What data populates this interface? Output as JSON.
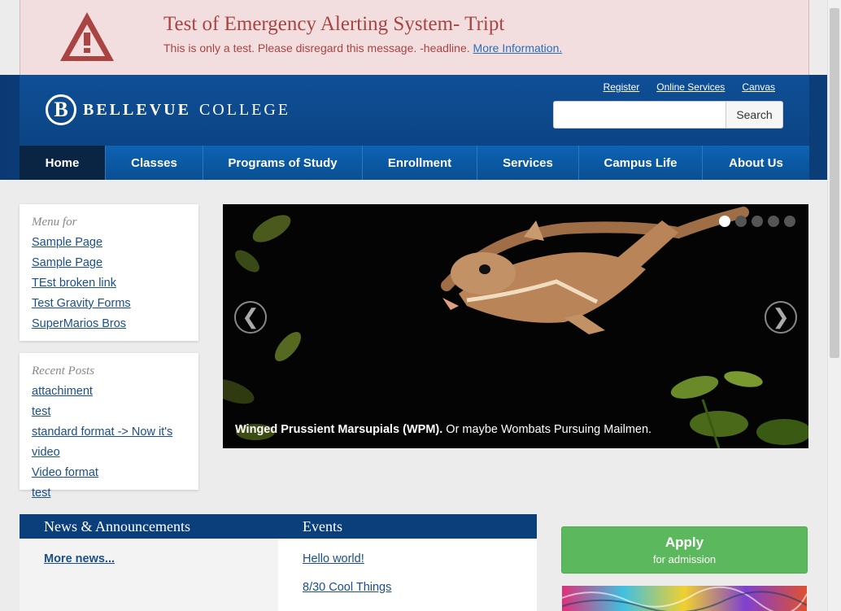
{
  "alert": {
    "title": "Test of Emergency Alerting System- Tript",
    "message": "This is only a test. Please disregard this message. -headline.",
    "link": "More Information.",
    "color": "#a94442"
  },
  "header": {
    "logo_mark": "B",
    "logo_bold": "BELLEVUE",
    "logo_rest": "COLLEGE",
    "toplinks": [
      "Register",
      "Online Services",
      "Canvas"
    ],
    "search_button": "Search",
    "search_value": ""
  },
  "nav": {
    "items": [
      "Home",
      "Classes",
      "Programs of Study",
      "Enrollment",
      "Services",
      "Campus Life",
      "About Us"
    ],
    "active": "Home"
  },
  "sidebar": {
    "menu": {
      "title": "Menu for",
      "items": [
        "Sample Page",
        "Sample Page",
        "TEst broken link",
        "Test Gravity Forms",
        "SuperMarios Bros"
      ]
    },
    "recent": {
      "title": "Recent Posts",
      "items": [
        "attachiment",
        "test",
        "standard format -> Now it's video",
        "Video format",
        "test"
      ]
    }
  },
  "slider": {
    "prev": "❮",
    "next": "❯",
    "caption_bold": "Winged Prussient Marsupials (WPM).",
    "caption_rest": " Or maybe Wombats Pursuing Mailmen.",
    "dots": 5,
    "active_dot": 1
  },
  "news": {
    "title": "News & Announcements",
    "more": "More news..."
  },
  "events": {
    "title": "Events",
    "items": [
      "Hello world!",
      "8/30 Cool Things"
    ]
  },
  "apply": {
    "title": "Apply",
    "subtitle": "for admission",
    "color": "#5cb85c"
  }
}
